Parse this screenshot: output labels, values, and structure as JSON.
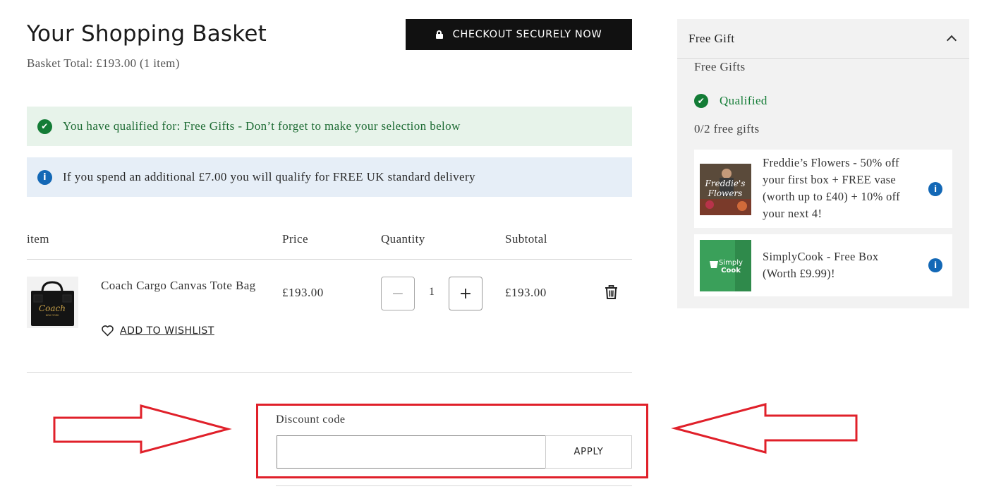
{
  "page": {
    "title": "Your Shopping Basket",
    "basket_total": "Basket Total: £193.00 (1 item)"
  },
  "checkout": {
    "label": "CHECKOUT SECURELY NOW",
    "icon": "lock-icon"
  },
  "banners": {
    "success": "You have qualified for: Free Gifts - Don’t forget to make your selection below",
    "info": "If you spend an additional £7.00 you will qualify for FREE UK standard delivery"
  },
  "table": {
    "headers": {
      "item": "item",
      "price": "Price",
      "quantity": "Quantity",
      "subtotal": "Subtotal"
    },
    "rows": [
      {
        "name": "Coach Cargo Canvas Tote Bag",
        "price": "£193.00",
        "quantity": "1",
        "subtotal": "£193.00",
        "image_text": "Coach",
        "image_subtext": "NEW YORK",
        "wishlist_label": "ADD TO WISHLIST"
      }
    ]
  },
  "discount": {
    "label": "Discount code",
    "value": "",
    "placeholder": "",
    "apply_label": "APPLY"
  },
  "gift_panel": {
    "title": "Free Gift",
    "subtitle": "Free Gifts",
    "status": "Qualified",
    "count": "0/2 free gifts",
    "items": [
      {
        "text": "Freddie’s Flowers - 50% off your first box + FREE vase (worth up to £40) + 10% off your next 4!",
        "logo_line1": "Freddie's",
        "logo_line2": "Flowers"
      },
      {
        "text": "SimplyCook - Free Box (Worth £9.99)!",
        "logo_line1": "Simply",
        "logo_line2": "Cook"
      }
    ]
  },
  "colors": {
    "success_green": "#137c36",
    "success_bg": "#e7f3ea",
    "info_blue": "#1368b6",
    "info_bg": "#e6eef7",
    "annotation_red": "#e0202a",
    "checkout_bg": "#111111"
  }
}
